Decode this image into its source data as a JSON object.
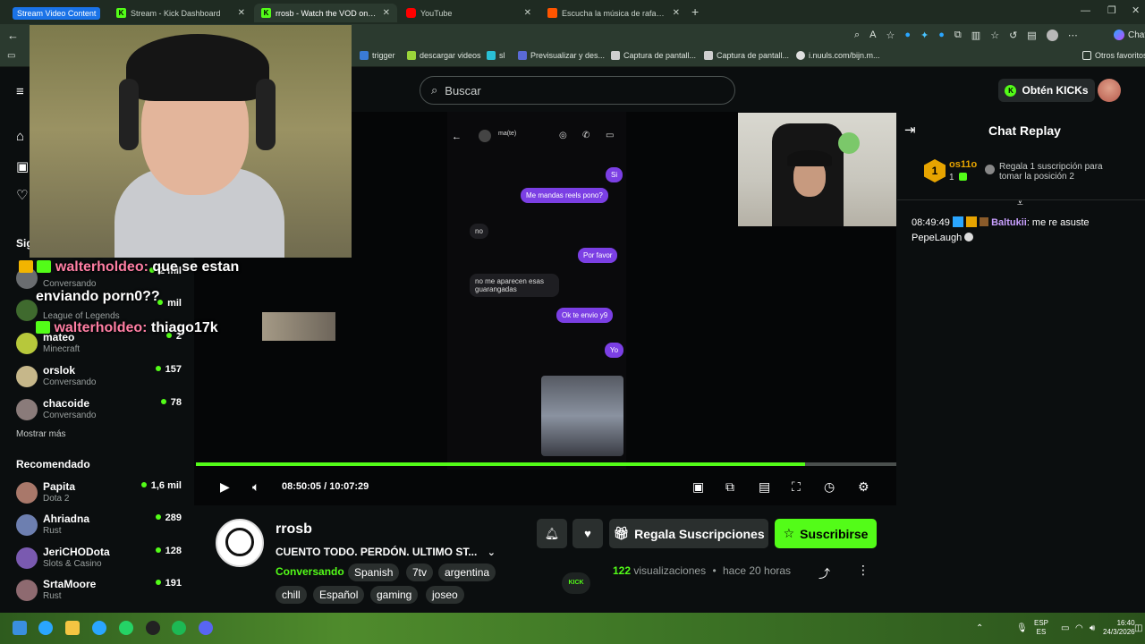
{
  "browser": {
    "tabs": [
      {
        "label": "Stream Video Content",
        "active": false
      },
      {
        "label": "Stream - Kick Dashboard",
        "active": false
      },
      {
        "label": "rrosb - Watch the VOD on Kick",
        "active": true
      },
      {
        "label": "YouTube",
        "active": false
      },
      {
        "label": "Escucha la música de rafaelotp | D",
        "active": false
      }
    ],
    "bookmarks": [
      {
        "label": "trigger"
      },
      {
        "label": "descargar videos"
      },
      {
        "label": "sl"
      },
      {
        "label": "Previsualizar y des..."
      },
      {
        "label": "Captura de pantall..."
      },
      {
        "label": "Captura de pantall..."
      },
      {
        "label": "i.nuuls.com/bijn.m..."
      },
      {
        "label": "Otros favoritos"
      }
    ],
    "ext_label": "Chat"
  },
  "header": {
    "search_placeholder": "Buscar",
    "get_kicks": "Obtén KICKs"
  },
  "sidebar": {
    "following_title": "Sig",
    "following": [
      {
        "name": "",
        "category": "Conversando",
        "viewers": "2 mil",
        "color": "#6a6d70"
      },
      {
        "name": "",
        "category": "League of Legends",
        "viewers": "mil",
        "color": "#3f6a2e"
      },
      {
        "name": "mateo",
        "category": "Minecraft",
        "viewers": "2",
        "color": "#b7c83b"
      },
      {
        "name": "orslok",
        "category": "Conversando",
        "viewers": "157",
        "color": "#c6b78a"
      },
      {
        "name": "chacoide",
        "category": "Conversando",
        "viewers": "78",
        "color": "#8a7b7a"
      }
    ],
    "show_more": "Mostrar más",
    "recommended_title": "Recomendado",
    "recommended": [
      {
        "name": "Papita",
        "category": "Dota 2",
        "viewers": "1,6 mil",
        "color": "#a9786a"
      },
      {
        "name": "Ahriadna",
        "category": "Rust",
        "viewers": "289",
        "color": "#6d7fb0"
      },
      {
        "name": "JeriCHODota",
        "category": "Slots & Casino",
        "viewers": "128",
        "color": "#7a5ab0"
      },
      {
        "name": "SrtaMoore",
        "category": "Rust",
        "viewers": "191",
        "color": "#8e6a70"
      }
    ]
  },
  "overlay": {
    "messages": [
      {
        "user": "walterholdeo:",
        "text": "que se estan"
      },
      {
        "user": "",
        "text": "enviando porn0??"
      },
      {
        "user": "walterholdeo:",
        "text": "thiago17k"
      }
    ]
  },
  "phone": {
    "contact": "ma(te)",
    "bubbles": [
      {
        "text": "Si",
        "me": true
      },
      {
        "text": "Me mandas reels pono?",
        "me": true
      },
      {
        "text": "no",
        "me": false
      },
      {
        "text": "Por favor",
        "me": true
      },
      {
        "text": "no me aparecen esas guarangadas",
        "me": false
      },
      {
        "text": "Ok te envio y9",
        "me": true
      },
      {
        "text": "Yo",
        "me": true
      }
    ]
  },
  "player": {
    "progress": 0.87,
    "current_time": "08:50:05",
    "separator": "/",
    "duration": "10:07:29"
  },
  "channel": {
    "name": "rrosb",
    "title": "CUENTO TODO. PERDÓN. ULTIMO ST...",
    "status": "Conversando",
    "tags": [
      "Spanish",
      "7tv",
      "argentina",
      "chill",
      "Español",
      "gaming",
      "joseo"
    ],
    "gift_label": "Regala Suscripciones",
    "subscribe_label": "Suscribirse",
    "views_count": "122",
    "views_label": "visualizaciones",
    "dot": "•",
    "ago": "hace 20 horas"
  },
  "chat": {
    "title": "Chat Replay",
    "pinned_user": "os11o",
    "pinned_count": "1",
    "pinned_text": "Regala 1 suscripción para tomar la posición 2",
    "message_time": "08:49:49",
    "message_user": "Baltukii",
    "message_text": ": me re asuste",
    "message_emote": "PepeLaugh"
  },
  "taskbar": {
    "lang": "ESP",
    "lang2": "ES",
    "time": "16:40",
    "date": "24/3/2026"
  },
  "colors": {
    "kick_green": "#53fc18",
    "purple_bubble": "#7b3fe4",
    "username_pink": "#ff7fa4",
    "chat_user": "#c9a0ff"
  }
}
